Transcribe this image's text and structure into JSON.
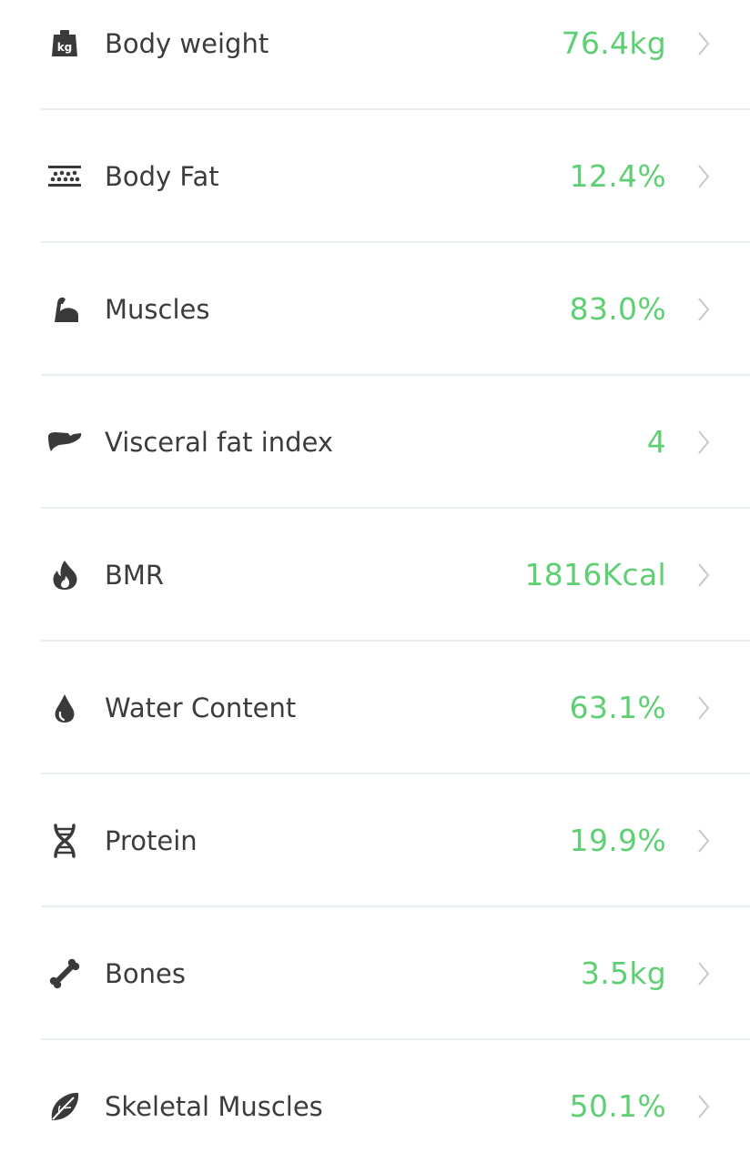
{
  "metrics": [
    {
      "label": "Body weight",
      "value": "76.4kg",
      "icon": "weight-kg-icon"
    },
    {
      "label": "Body Fat",
      "value": "12.4%",
      "icon": "body-fat-icon"
    },
    {
      "label": "Muscles",
      "value": "83.0%",
      "icon": "muscle-arm-icon"
    },
    {
      "label": "Visceral fat index",
      "value": "4",
      "icon": "liver-icon"
    },
    {
      "label": "BMR",
      "value": "1816Kcal",
      "icon": "flame-icon"
    },
    {
      "label": "Water Content",
      "value": "63.1%",
      "icon": "water-drop-icon"
    },
    {
      "label": "Protein",
      "value": "19.9%",
      "icon": "dna-icon"
    },
    {
      "label": "Bones",
      "value": "3.5kg",
      "icon": "bone-icon"
    },
    {
      "label": "Skeletal Muscles",
      "value": "50.1%",
      "icon": "leaf-muscle-icon"
    }
  ],
  "colors": {
    "value_green": "#5fcf74",
    "label_text": "#3c3c3c",
    "icon_dark": "#3a3a3a",
    "chevron": "#c8c8c8",
    "divider": "#e6eef0"
  }
}
